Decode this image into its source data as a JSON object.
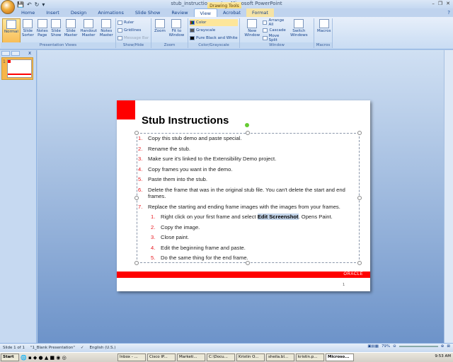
{
  "window": {
    "title": "stub_instructions.pptx - Microsoft PowerPoint",
    "context_tab": "Drawing Tools",
    "controls": [
      "–",
      "❐",
      "✕"
    ]
  },
  "qat": {
    "save": "💾",
    "undo": "↶",
    "redo": "↻",
    "more": "▾"
  },
  "tabs": [
    "Home",
    "Insert",
    "Design",
    "Animations",
    "Slide Show",
    "Review",
    "View",
    "Acrobat",
    "Format"
  ],
  "active_tab": "View",
  "ribbon": {
    "presentation_views": {
      "label": "Presentation Views",
      "buttons": [
        "Normal",
        "Slide Sorter",
        "Notes Page",
        "Slide Show",
        "Slide Master",
        "Handout Master",
        "Notes Master"
      ]
    },
    "show_hide": {
      "label": "Show/Hide",
      "items": [
        "Ruler",
        "Gridlines",
        "Message Bar"
      ]
    },
    "zoom": {
      "label": "Zoom",
      "buttons": [
        "Zoom",
        "Fit to Window"
      ]
    },
    "color": {
      "label": "Color/Grayscale",
      "items": [
        "Color",
        "Grayscale",
        "Pure Black and White"
      ]
    },
    "window": {
      "label": "Window",
      "new": "New Window",
      "items": [
        "Arrange All",
        "Cascade",
        "Move Split"
      ],
      "switch": "Switch Windows"
    },
    "macros": {
      "label": "Macros",
      "button": "Macros"
    }
  },
  "pane": {
    "close": "x",
    "slide_number": "1"
  },
  "slide": {
    "title": "Stub Instructions",
    "items": [
      {
        "n": "1.",
        "text": "Copy this stub demo and paste special."
      },
      {
        "n": "2.",
        "text": "Rename the stub."
      },
      {
        "n": "3.",
        "text": "Make sure it's linked to the Extensibility Demo project."
      },
      {
        "n": "4.",
        "text": "Copy frames you want in the demo."
      },
      {
        "n": "5.",
        "text": "Paste them into the stub."
      },
      {
        "n": "6.",
        "text": "Delete the frame that was in the original stub file. You can't delete the start and end frames."
      },
      {
        "n": "7.",
        "text": "Replace the starting and ending frame images with the images from your frames."
      }
    ],
    "subitems": [
      {
        "n": "1.",
        "pre": "Right click on your first frame and select ",
        "bold": "Edit Screenshot",
        "post": ". Opens Paint."
      },
      {
        "n": "2.",
        "text": "Copy the image."
      },
      {
        "n": "3.",
        "text": "Close paint."
      },
      {
        "n": "4.",
        "text": "Edit the beginning frame and paste."
      },
      {
        "n": "5.",
        "text": "Do the same thing for the end frame."
      }
    ],
    "logo": "ORACLE",
    "page": "1",
    "accent": "#ff0000"
  },
  "status": {
    "slide": "Slide 1 of 1",
    "theme": "\"1_Blank Presentation\"",
    "language": "English (U.S.)",
    "zoom": "79%"
  },
  "taskbar": {
    "start": "Start",
    "items": [
      "Inbox - ...",
      "Cisco IP...",
      "Marketi...",
      "C:\\Docu...",
      "Kristin O...",
      "sheila.bl...",
      "kristin.p...",
      "Microso..."
    ],
    "clock": "9:53 AM"
  }
}
